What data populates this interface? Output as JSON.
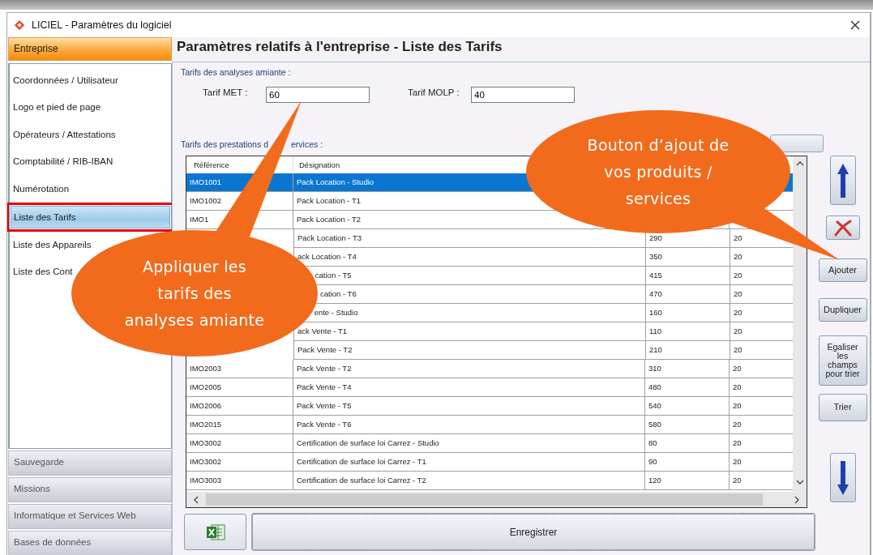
{
  "window": {
    "title": "LICIEL - Paramètres du logiciel"
  },
  "sidebar": {
    "header": "Entreprise",
    "items": [
      {
        "label": "Coordonnées / Utilisateur",
        "selected": false
      },
      {
        "label": "Logo et pied de page",
        "selected": false
      },
      {
        "label": "Opérateurs / Attestations",
        "selected": false
      },
      {
        "label": "Comptabilité / RIB-IBAN",
        "selected": false
      },
      {
        "label": "Numérotation",
        "selected": false
      },
      {
        "label": "Liste des Tarifs",
        "selected": true
      },
      {
        "label": "Liste des Appareils",
        "selected": false
      },
      {
        "label": "Liste des Cont",
        "selected": false
      }
    ],
    "sections": [
      "Sauvegarde",
      "Missions",
      "Informatique et Services Web",
      "Bases de données"
    ]
  },
  "page_title": "Paramètres relatifs à l'entreprise - Liste des Tarifs",
  "asbestos": {
    "heading": "Tarifs des analyses amiante :",
    "fields": [
      {
        "label": "Tarif MET :",
        "value": "60"
      },
      {
        "label": "Tarif MOLP :",
        "value": "40"
      }
    ]
  },
  "services": {
    "heading_parts": [
      "Tarifs des prestations d",
      "ervices :"
    ],
    "table": {
      "columns": [
        "Référence",
        "Désignation"
      ],
      "rows": [
        {
          "reference": "IMO1001",
          "designation": "Pack Location - Studio",
          "selected": true
        },
        {
          "reference": "IMO1002",
          "designation": "Pack Location - T1",
          "selected": false
        },
        {
          "reference": "IMO1",
          "designation": "Pack Location - T2",
          "selected": false
        },
        {
          "designation": "Pack Location - T3",
          "column_3": "290",
          "column_4": "20",
          "selected": false
        },
        {
          "designation": "ack Location - T4",
          "column_3": "350",
          "column_4": "20",
          "selected": false
        },
        {
          "designation": "cation - T5",
          "column_3": "415",
          "column_4": "20",
          "selected": false
        },
        {
          "designation": "cation - T6",
          "column_3": "470",
          "column_4": "20",
          "selected": false
        },
        {
          "designation": "ente - Studio",
          "column_3": "160",
          "column_4": "20",
          "selected": false
        },
        {
          "designation": "ack Vente - T1",
          "column_3": "110",
          "column_4": "20",
          "selected": false
        },
        {
          "designation": "Pack Vente - T2",
          "column_3": "210",
          "column_4": "20",
          "selected": false
        },
        {
          "reference": "IMO2003",
          "designation": "Pack Vente - T2",
          "column_3": "310",
          "column_4": "20",
          "selected": false
        },
        {
          "reference": "IMO2005",
          "designation": "Pack Vente - T4",
          "column_3": "480",
          "column_4": "20",
          "selected": false
        },
        {
          "reference": "IMO2006",
          "designation": "Pack Vente - T5",
          "column_3": "540",
          "column_4": "20",
          "selected": false
        },
        {
          "reference": "IMO2015",
          "designation": "Pack Vente - T6",
          "column_3": "580",
          "column_4": "20",
          "selected": false
        },
        {
          "reference": "IMO3002",
          "designation": "Certification de surface loi Carrez - Studio",
          "column_3": "80",
          "column_4": "20",
          "selected": false
        },
        {
          "reference": "IMO3002",
          "designation": "Certification de surface loi Carrez - T1",
          "column_3": "90",
          "column_4": "20",
          "selected": false
        },
        {
          "reference": "IMO3003",
          "designation": "Certification de surface loi Carrez - T2",
          "column_3": "120",
          "column_4": "20",
          "selected": false
        }
      ]
    }
  },
  "side_buttons": [
    {
      "kind": "up"
    },
    {
      "kind": "delete"
    },
    {
      "kind": "text",
      "label": "Ajouter"
    },
    {
      "kind": "text",
      "label": "Dupliquer"
    },
    {
      "kind": "text",
      "label": "Egaliser les champs pour trier"
    },
    {
      "kind": "text",
      "label": "Trier"
    },
    {
      "kind": "down"
    }
  ],
  "save_button": "Enregistrer",
  "callouts": [
    {
      "lines": [
        "Appliquer les",
        "tarifs des",
        "analyses amiante"
      ]
    },
    {
      "lines": [
        "Bouton d’ajout de",
        "vos produits /",
        "services"
      ]
    }
  ]
}
